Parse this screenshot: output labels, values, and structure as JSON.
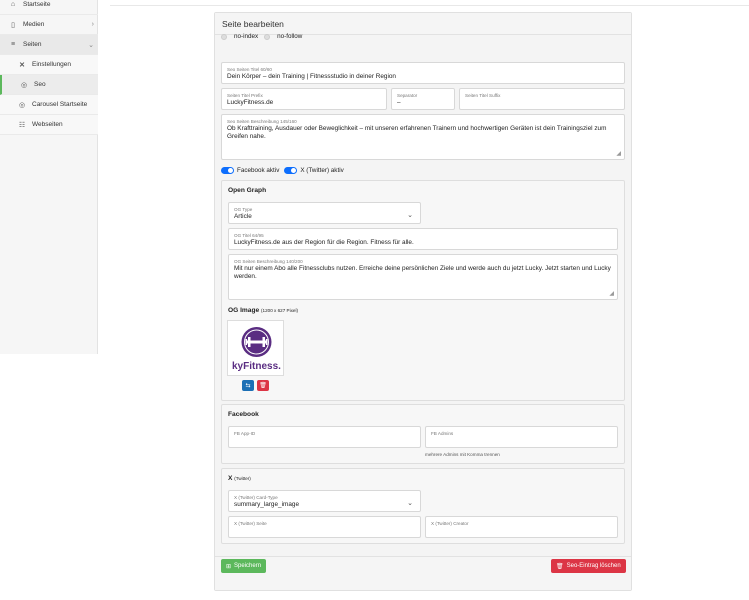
{
  "sidebar": {
    "items": [
      {
        "label": "Startseite",
        "icon": "home-icon"
      },
      {
        "label": "Medien",
        "icon": "file-icon"
      },
      {
        "label": "Seiten",
        "icon": "list-icon"
      },
      {
        "label": "Einstellungen",
        "icon": "wrench-icon"
      },
      {
        "label": "Seo",
        "icon": "eye-icon"
      },
      {
        "label": "Carousel Startseite",
        "icon": "target-icon"
      },
      {
        "label": "Webseiten",
        "icon": "grid-icon"
      }
    ]
  },
  "card": {
    "title": "Seite bearbeiten"
  },
  "robots": {
    "noindex": "no-index",
    "nofollow": "no-follow"
  },
  "seo": {
    "title_label": "Seo Seiten Titel 60/60",
    "title_value": "Dein Körper – dein Training | Fitnessstudio in deiner Region",
    "prefix_label": "Seiten Titel Prefix",
    "prefix_value": "LuckyFitness.de",
    "separator_label": "Separator",
    "separator_value": "–",
    "suffix_label": "Seiten Titel Suffix",
    "suffix_value": "",
    "desc_label": "Seo Seiten Beschreibung 145/160",
    "desc_value": "Ob Krafttraining, Ausdauer oder Beweglichkeit – mit unseren erfahrenen Trainern und hochwertigen Geräten ist dein Trainingsziel zum Greifen nahe."
  },
  "toggles": {
    "facebook": "Facebook aktiv",
    "twitter": "X (Twitter) aktiv"
  },
  "og": {
    "heading": "Open Graph",
    "type_label": "OG Type",
    "type_value": "Article",
    "title_label": "OG Titel 64/95",
    "title_value": "LuckyFitness.de aus der Region für die Region. Fitness für alle.",
    "desc_label": "OG Seiten Beschreibung 140/200",
    "desc_value": "Mit nur einem Abo alle Fitnessclubs nutzen. Erreiche deine persönlichen Ziele und werde auch du jetzt Lucky. Jetzt starten und Lucky werden.",
    "image_heading": "OG Image",
    "image_hint": "(1200 x 627 Pixel)",
    "logo_text": "kyFitness."
  },
  "facebook": {
    "heading": "Facebook",
    "app_id_label": "FB App-ID",
    "admins_label": "FB Admins",
    "admins_hint": "mehrere Admins mit Komma trennen"
  },
  "twitter": {
    "heading": "X",
    "heading_small": "(Twitter)",
    "card_label": "X (Twitter) Card-Type",
    "card_value": "summary_large_image",
    "site_label": "X (Twitter) Seite",
    "creator_label": "X (Twitter) Creator"
  },
  "buttons": {
    "save": "Speichern",
    "delete": "Seo-Eintrag löschen"
  },
  "colors": {
    "accent": "#0d6efd",
    "save": "#5cb85c",
    "danger": "#dc3545",
    "info": "#1b6fb5",
    "logo": "#5a2d82"
  }
}
